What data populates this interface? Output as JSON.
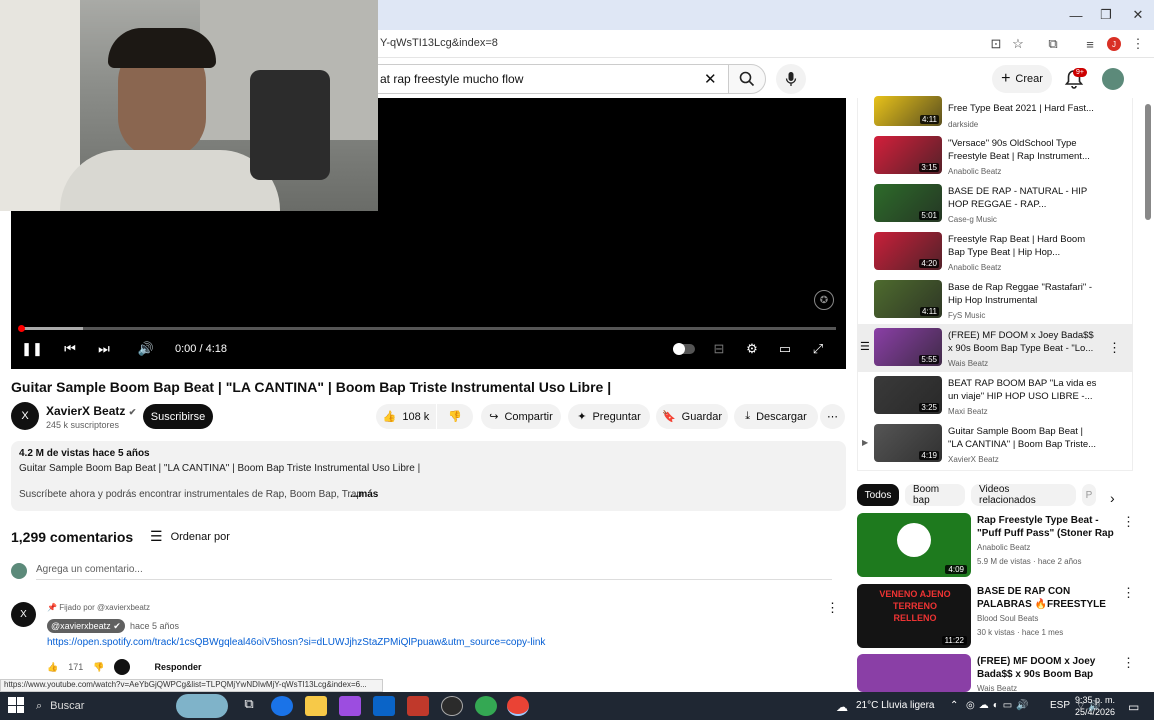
{
  "browser": {
    "url": "Y-qWsTI13Lcg&index=8",
    "status_url": "https://www.youtube.com/watch?v=AeYbGjQWPCg&list=TLPQMjYwNDIwMjY-qWsTI13Lcg&index=6..."
  },
  "header": {
    "search_value": "at rap freestyle mucho flow",
    "create_label": "Crear",
    "notif_badge": "9+",
    "profile_initial": "J"
  },
  "player": {
    "time": "0:00 / 4:18",
    "progress": 0.0
  },
  "video": {
    "title": "Guitar Sample Boom Bap Beat | \"LA CANTINA\" | Boom Bap Triste Instrumental Uso Libre |",
    "channel": "XavierX Beatz",
    "subs": "245 k suscriptores",
    "subscribe": "Suscribirse",
    "likes": "108 k",
    "share": "Compartir",
    "ask": "Preguntar",
    "save": "Guardar",
    "download": "Descargar",
    "channel_initial": "X"
  },
  "description": {
    "meta": "4.2 M de vistas  hace 5 años",
    "line1": "Guitar Sample Boom Bap Beat | \"LA CANTINA\" | Boom Bap Triste Instrumental Uso Libre |",
    "line2": "Suscríbete ahora y podrás encontrar instrumentales de Rap, Boom Bap, Trap",
    "more": "...más"
  },
  "comments": {
    "count": "1,299 comentarios",
    "sort": "Ordenar por",
    "add": "Agrega un comentario...",
    "pinned": "Fijado por @xavierxbeatz",
    "author": "@xavierxbeatz",
    "time": "hace 5 años",
    "link": "https://open.spotify.com/track/1csQBWgqleal46oiV5hosn?si=dLUWJjhzStaZPMiQlPpuaw&utm_source=copy-link",
    "likes": "171",
    "reply": "Responder"
  },
  "playlist": [
    {
      "title": "Free Type Beat 2021 | Hard Fast...",
      "channel": "darkside",
      "duration": "4:11",
      "color": "#e8c21a"
    },
    {
      "title": "\"Versace\" 90s OldSchool Type Freestyle Beat | Rap Instrument...",
      "channel": "Anabolic Beatz",
      "duration": "3:15",
      "color": "#d31f3b"
    },
    {
      "title": "BASE DE RAP - NATURAL - HIP HOP REGGAE - RAP...",
      "channel": "Case-g Music",
      "duration": "5:01",
      "color": "#2d6b2a"
    },
    {
      "title": "Freestyle Rap Beat | Hard Boom Bap Type Beat | Hip Hop...",
      "channel": "Anabolic Beatz",
      "duration": "4:20",
      "color": "#c8203a"
    },
    {
      "title": "Base de Rap Reggae \"Rastafari\" - Hip Hop Instrumental",
      "channel": "FyS Music",
      "duration": "4:11",
      "color": "#4e6b2e"
    },
    {
      "title": "(FREE) MF DOOM x Joey Bada$$ x 90s Boom Bap Type Beat - \"Lo...",
      "channel": "Wais Beatz",
      "duration": "5:55",
      "color": "#8a3fa6"
    },
    {
      "title": "BEAT RAP BOOM BAP \"La vida es un viaje\" HIP HOP USO LIBRE -...",
      "channel": "Maxi Beatz",
      "duration": "3:25",
      "color": "#3a3a3a"
    },
    {
      "title": "Guitar Sample Boom Bap Beat | \"LA CANTINA\" | Boom Bap Triste...",
      "channel": "XavierX Beatz",
      "duration": "4:19",
      "color": "#555555"
    }
  ],
  "chips": [
    "Todos",
    "Boom bap",
    "Videos relacionados",
    "P"
  ],
  "recommended": [
    {
      "title": "Rap Freestyle Type Beat - \"Puff Puff Pass\" (Stoner Rap Beat)",
      "channel": "Anabolic Beatz",
      "meta": "5.9 M de vistas · hace 2 años",
      "duration": "4:09",
      "color": "#1e7a1e"
    },
    {
      "title": "BASE DE RAP CON PALABRAS 🔥FREESTYLE RAP BEAT | ...",
      "channel": "Blood Soul Beats",
      "meta": "30 k vistas · hace 1 mes",
      "duration": "11:22",
      "color": "#141414"
    },
    {
      "title": "(FREE) MF DOOM x Joey Bada$$ x 90s Boom Bap Type ...",
      "channel": "Wais Beatz",
      "meta": "",
      "duration": "",
      "color": "#8a3fa6"
    }
  ],
  "recommended_overlay": "VENENO AJENO TERRENO RELLENO",
  "taskbar": {
    "search": "Buscar",
    "weather": "21°C  Lluvia ligera",
    "lang": "ESP",
    "time": "9:35 p. m.",
    "date": "25/4/2026"
  }
}
